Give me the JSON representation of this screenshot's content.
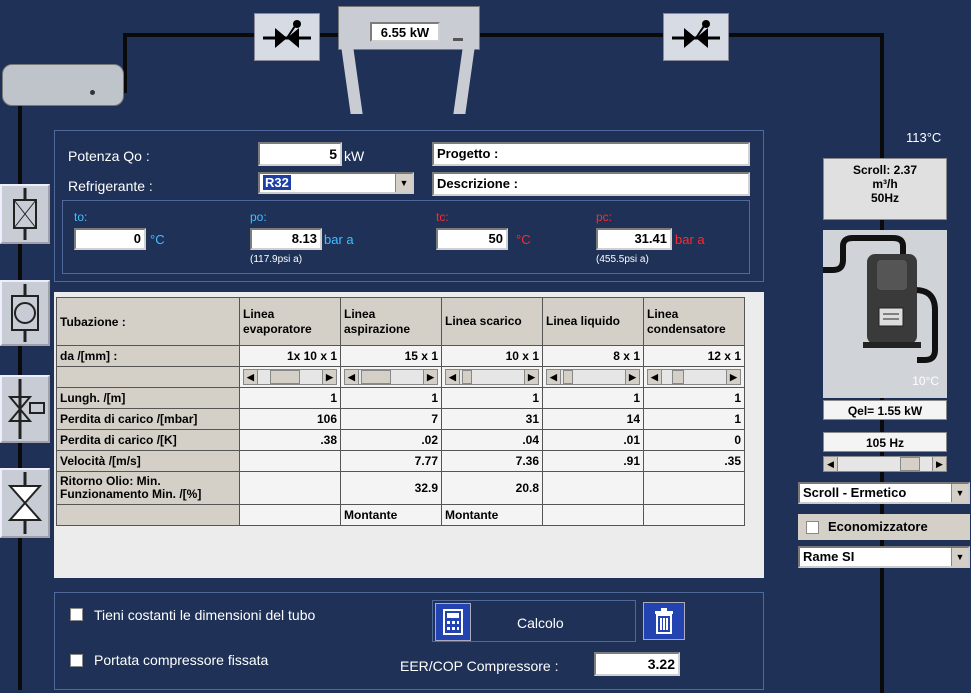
{
  "top": {
    "condenser_power": "6.55 kW",
    "temp_right": "113°C"
  },
  "inputs": {
    "potenza_label": "Potenza Qo :",
    "potenza_value": "5",
    "potenza_unit": "kW",
    "refrigerante_label": "Refrigerante :",
    "refrigerante_value": "R32",
    "progetto_label": "Progetto :",
    "descrizione_label": "Descrizione :"
  },
  "conditions": {
    "to_label": "to:",
    "to_value": "0",
    "to_unit": "°C",
    "po_label": "po:",
    "po_value": "8.13",
    "po_unit": "bar a",
    "po_psi": "(117.9psi a)",
    "tc_label": "tc:",
    "tc_value": "50",
    "tc_unit": "°C",
    "pc_label": "pc:",
    "pc_value": "31.41",
    "pc_unit": "bar a",
    "pc_psi": "(455.5psi a)"
  },
  "table": {
    "header_label": "Tubazione :",
    "columns": [
      "Linea evaporatore",
      "Linea aspirazione",
      "Linea scarico",
      "Linea liquido",
      "Linea condensatore"
    ],
    "rows": [
      {
        "label": "da  /[mm] :",
        "values": [
          "1x 10 x 1",
          "15 x 1",
          "10 x 1",
          "8 x 1",
          "12 x 1"
        ]
      },
      {
        "label": "Lungh. /[m]",
        "values": [
          "1",
          "1",
          "1",
          "1",
          "1"
        ]
      },
      {
        "label": "Perdita di carico /[mbar]",
        "values": [
          "106",
          "7",
          "31",
          "14",
          "1"
        ]
      },
      {
        "label": "Perdita di carico /[K]",
        "values": [
          ".38",
          ".02",
          ".04",
          ".01",
          "0"
        ]
      },
      {
        "label": "Velocità /[m/s]",
        "values": [
          "",
          "7.77",
          "7.36",
          ".91",
          ".35"
        ]
      },
      {
        "label": "Ritorno Olio: Min. Funzionamento Min. /[%]",
        "values": [
          "",
          "32.9",
          "20.8",
          "",
          ""
        ]
      },
      {
        "label": "",
        "values": [
          "",
          "Montante",
          "Montante",
          "",
          ""
        ]
      }
    ]
  },
  "compressor": {
    "scroll_info_line1": "Scroll:  2.37",
    "scroll_info_line2": "m³/h",
    "scroll_info_line3": "50Hz",
    "temp_low": "10°C",
    "qel": "Qel= 1.55 kW",
    "freq": "105 Hz",
    "type_select": "Scroll - Ermetico",
    "economizer_label": "Economizzatore",
    "material_select": "Rame SI"
  },
  "bottom": {
    "keep_dims_label": "Tieni costanti le dimensioni del tubo",
    "fixed_flow_label": "Portata compressore fissata",
    "calc_label": "Calcolo",
    "eer_label": "EER/COP Compressore :",
    "eer_value": "3.22"
  }
}
